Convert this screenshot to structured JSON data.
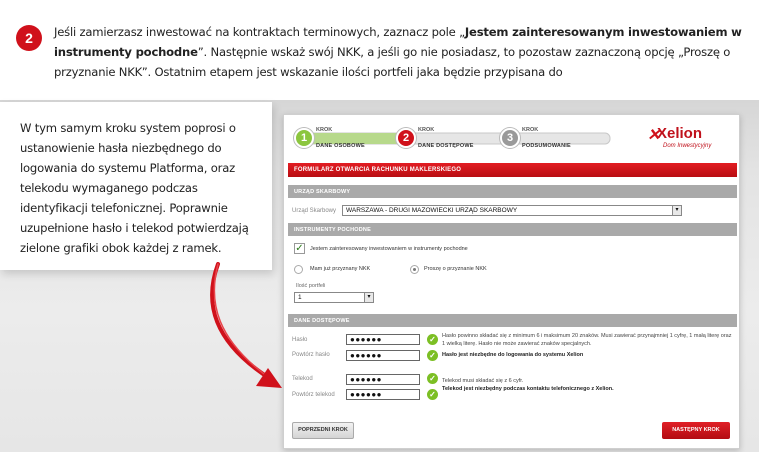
{
  "intro": {
    "badge": "2",
    "text_1": "Jeśli zamierzasz inwestować na kontraktach terminowych, zaznacz pole „",
    "text_bold": "Jestem zainteresowanym inwestowaniem w instrumenty pochodne",
    "text_2": "”. Następnie wskaż swój NKK, a jeśli go nie posiadasz, to pozostaw zaznaczoną opcję „Proszę o przyznanie NKK”. Ostatnim etapem jest wskazanie ilości portfeli jaka będzie przypisana do"
  },
  "side_text": "W tym samym kroku system poprosi o ustanowienie hasła niezbędnego do logowania do systemu Platforma, oraz telekodu wymaganego podczas identyfikacji telefonicznej. Poprawnie uzupełnione hasło i telekod potwierdzają zielone grafiki obok każdej z ramek.",
  "form": {
    "steps": [
      {
        "num": "1",
        "krok": "KROK",
        "name": "DANE OSOBOWE",
        "color": "#8cc63f"
      },
      {
        "num": "2",
        "krok": "KROK",
        "name": "DANE DOSTĘPOWE",
        "color": "#d0111b"
      },
      {
        "num": "3",
        "krok": "KROK",
        "name": "PODSUMOWANIE",
        "color": "#9a9a9a"
      }
    ],
    "logo": {
      "name": "Xelion",
      "sub": "Dom Inwestycyjny"
    },
    "title": "FORMULARZ OTWARCIA RACHUNKU MAKLERSKIEGO",
    "urzad": {
      "header": "URZĄD SKARBOWY",
      "label": "Urząd Skarbowy",
      "value": "WARSZAWA - DRUGI MAZOWIECKI URZĄD SKARBOWY"
    },
    "instrumenty": {
      "header": "INSTRUMENTY POCHODNE",
      "checkbox_label": "Jestem zainteresowany inwestowaniem w instrumenty pochodne",
      "checkbox_checked": true,
      "radio_1": "Mam już przyznany NKK",
      "radio_2": "Proszę o przyznanie NKK",
      "radio_selected": "radio_2",
      "portfele_label": "Ilość portfeli",
      "portfele_value": "1"
    },
    "dostep": {
      "header": "DANE DOSTĘPOWE",
      "haslo_label": "Hasło",
      "haslo_value": "●●●●●●",
      "powtorz_haslo_label": "Powtórz hasło",
      "powtorz_haslo_value": "●●●●●●",
      "haslo_hint": "Hasło powinno składać się z minimum 6 i maksimum 20 znaków. Musi zawierać przynajmniej 1 cyfrę, 1 małą literę oraz 1 wielką literę. Hasło nie może zawierać znaków specjalnych.",
      "haslo_hint_bold": "Hasło jest niezbędne do logowania do systemu Xelion",
      "telekod_label": "Telekod",
      "telekod_value": "●●●●●●",
      "powtorz_telekod_label": "Powtórz telekod",
      "powtorz_telekod_value": "●●●●●●",
      "telekod_hint": "Telekod musi składać się z 6 cyfr.",
      "telekod_hint_bold": "Telekod jest niezbędny podczas kontaktu telefonicznego z Xelion."
    },
    "btn_prev": "POPRZEDNI KROK",
    "btn_next": "NASTĘPNY KROK"
  },
  "colors": {
    "accent": "#d0111b",
    "ok": "#7cbf24",
    "section": "#a9a9a9"
  }
}
